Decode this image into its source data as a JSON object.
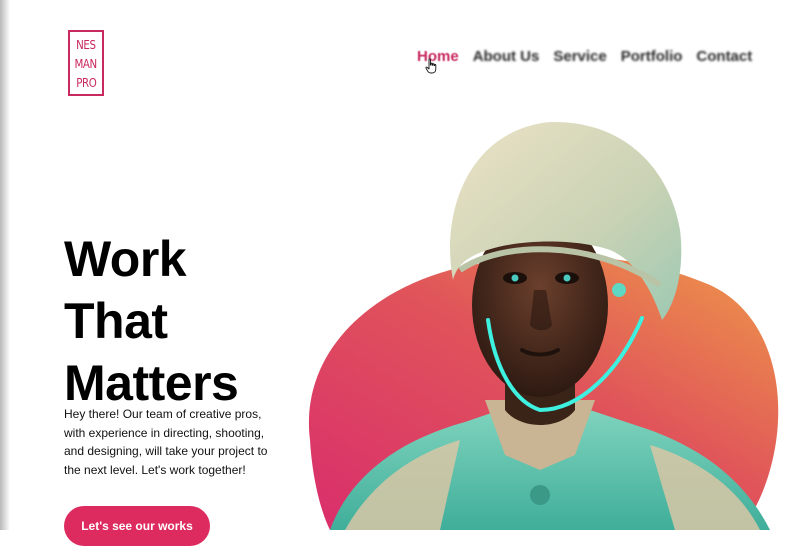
{
  "logo": {
    "lines": [
      "NES",
      "MAN",
      "PRO"
    ]
  },
  "nav": {
    "items": [
      {
        "label": "Home",
        "active": true
      },
      {
        "label": "About Us",
        "active": false
      },
      {
        "label": "Service",
        "active": false
      },
      {
        "label": "Portfolio",
        "active": false
      },
      {
        "label": "Contact",
        "active": false
      }
    ]
  },
  "hero": {
    "headline": [
      "Work",
      "That",
      "Matters"
    ],
    "intro": "Hey there! Our team of creative pros, with experience in directing, shooting, and designing, will take your project to the next level. Let's work together!",
    "cta_label": "Let's see our works",
    "image_subject": "portrait-of-person-in-helmet"
  },
  "colors": {
    "brand": "#c8295e",
    "button": "#dd2b60",
    "blob_start": "#d92d6c",
    "blob_end": "#ee9a48",
    "glow": "#3df0e0",
    "text": "#111111"
  }
}
